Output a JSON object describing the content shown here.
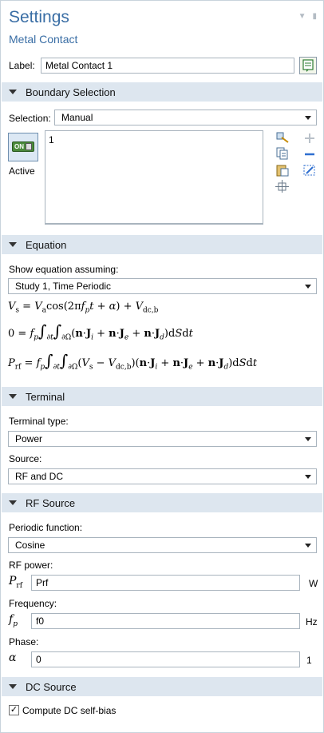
{
  "header": {
    "title": "Settings",
    "subtitle": "Metal Contact"
  },
  "label_row": {
    "label": "Label:",
    "value": "Metal Contact 1"
  },
  "boundary": {
    "section_title": "Boundary Selection",
    "selection_label": "Selection:",
    "selection_value": "Manual",
    "active_badge": "ON",
    "active_label": "Active",
    "list_items": [
      "1"
    ]
  },
  "equation": {
    "section_title": "Equation",
    "show_label": "Show equation assuming:",
    "study_value": "Study 1, Time Periodic"
  },
  "terminal": {
    "section_title": "Terminal",
    "type_label": "Terminal type:",
    "type_value": "Power",
    "source_label": "Source:",
    "source_value": "RF and DC"
  },
  "rf_source": {
    "section_title": "RF Source",
    "periodic_label": "Periodic function:",
    "periodic_value": "Cosine",
    "power_label": "RF power:",
    "power_value": "Prf",
    "power_unit": "W",
    "freq_label": "Frequency:",
    "freq_value": "f0",
    "freq_unit": "Hz",
    "phase_label": "Phase:",
    "phase_value": "0",
    "phase_unit": "1"
  },
  "dc_source": {
    "section_title": "DC Source",
    "checkbox_label": "Compute DC self-bias",
    "checked": true
  }
}
